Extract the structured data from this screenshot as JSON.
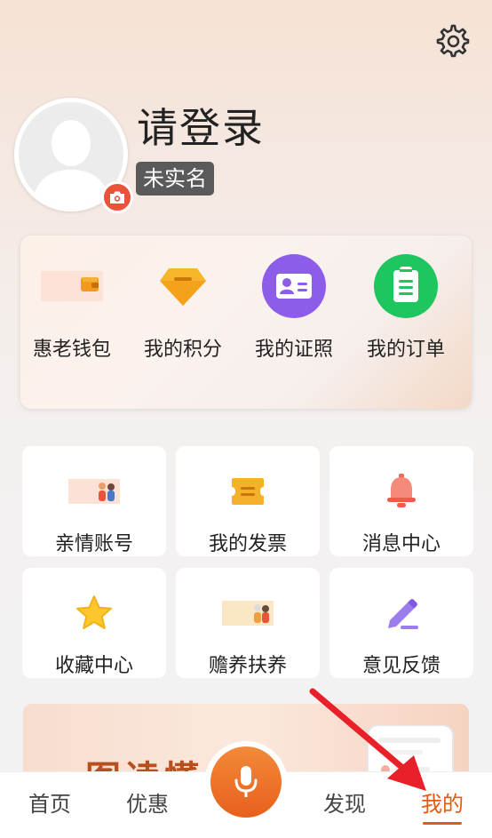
{
  "header": {
    "login_title": "请登录",
    "realname_status": "未实名",
    "settings_icon": "gear-icon",
    "camera_icon": "camera-icon"
  },
  "quick_menu": [
    {
      "label": "惠老钱包",
      "icon": "wallet-icon"
    },
    {
      "label": "我的积分",
      "icon": "diamond-icon"
    },
    {
      "label": "我的证照",
      "icon": "id-card-icon"
    },
    {
      "label": "我的订单",
      "icon": "clipboard-icon"
    }
  ],
  "tiles": [
    {
      "label": "亲情账号",
      "icon": "family-icon"
    },
    {
      "label": "我的发票",
      "icon": "ticket-icon"
    },
    {
      "label": "消息中心",
      "icon": "bell-icon"
    },
    {
      "label": "收藏中心",
      "icon": "star-icon"
    },
    {
      "label": "赡养扶养",
      "icon": "elderly-care-icon"
    },
    {
      "label": "意见反馈",
      "icon": "edit-icon"
    }
  ],
  "banner": {
    "text": "一图读懂"
  },
  "tabbar": {
    "items": [
      {
        "label": "首页"
      },
      {
        "label": "优惠"
      },
      {
        "label": "发现"
      },
      {
        "label": "我的"
      }
    ],
    "active": "我的",
    "mic_icon": "microphone-icon"
  },
  "colors": {
    "accent": "#e55a10",
    "camera_badge": "#e8533a",
    "annotation_arrow": "#e8202a"
  }
}
